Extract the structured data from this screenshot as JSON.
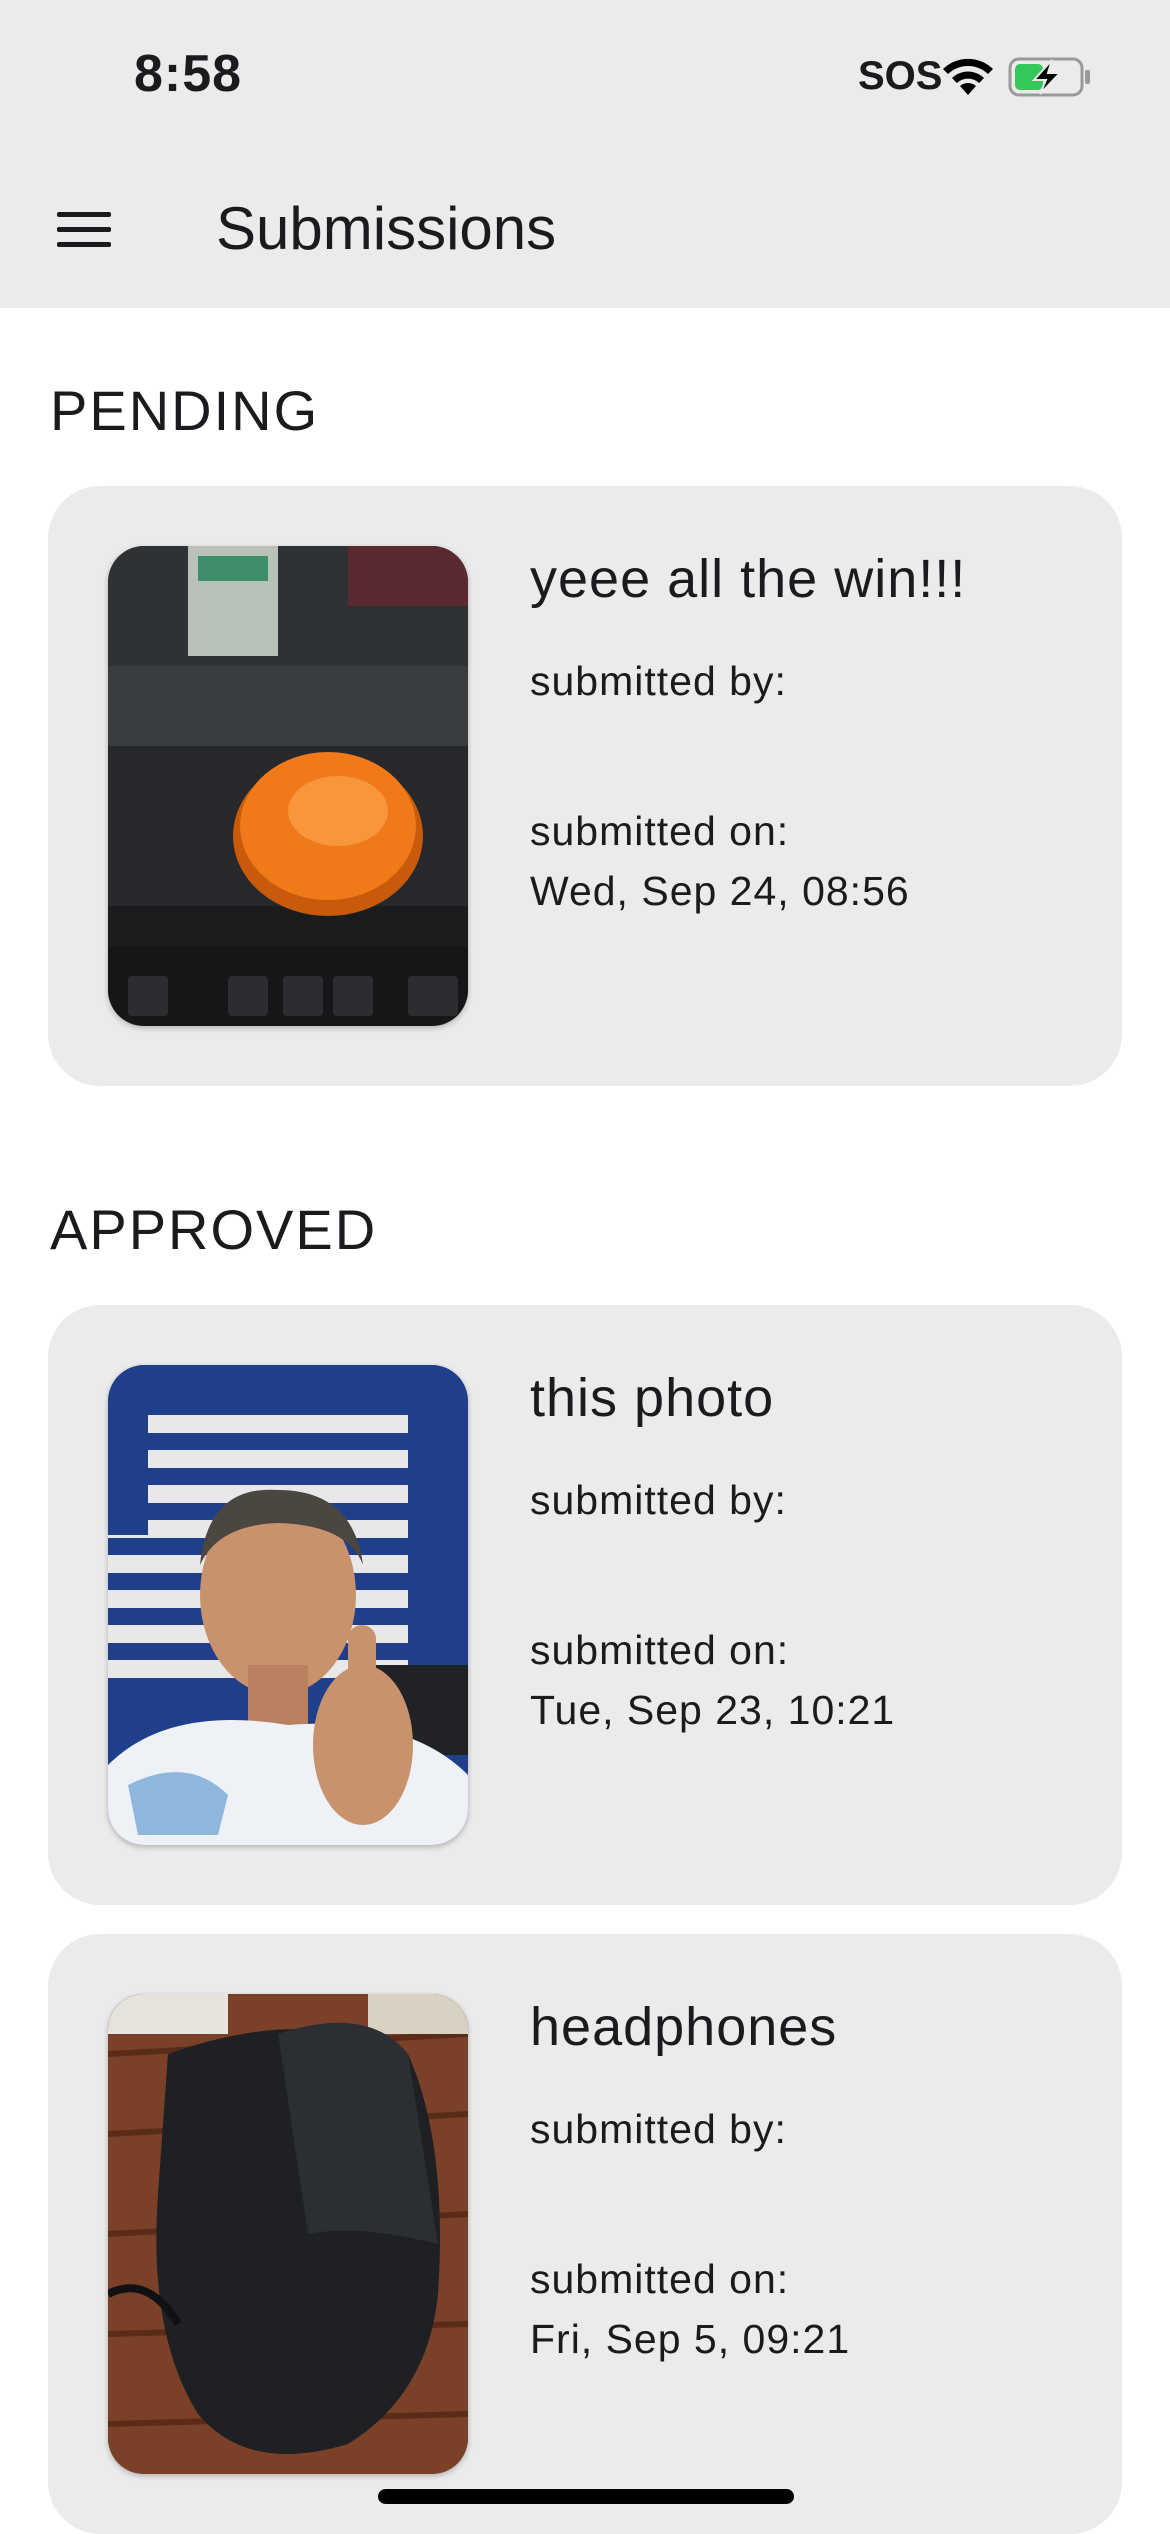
{
  "status_bar": {
    "time": "8:58",
    "carrier": "SOS"
  },
  "app_bar": {
    "title": "Submissions",
    "menu_icon": "hamburger-menu-icon"
  },
  "sections": {
    "pending": {
      "label": "PENDING",
      "items": [
        {
          "title": "yeee all the win!!!",
          "submitted_by_label": "submitted by:",
          "submitted_by": "",
          "submitted_on_label": "submitted on:",
          "submitted_on": "Wed, Sep 24, 08:56"
        }
      ]
    },
    "approved": {
      "label": "APPROVED",
      "items": [
        {
          "title": "this photo",
          "submitted_by_label": "submitted by:",
          "submitted_by": "",
          "submitted_on_label": "submitted on:",
          "submitted_on": "Tue, Sep 23, 10:21"
        },
        {
          "title": "headphones",
          "submitted_by_label": "submitted by:",
          "submitted_by": "",
          "submitted_on_label": "submitted on:",
          "submitted_on": "Fri, Sep 5, 09:21"
        }
      ]
    }
  },
  "colors": {
    "app_bar_bg": "#ebebeb",
    "card_bg": "#ebebeb",
    "text": "#1b1b1f",
    "battery_charge": "#34c759"
  }
}
